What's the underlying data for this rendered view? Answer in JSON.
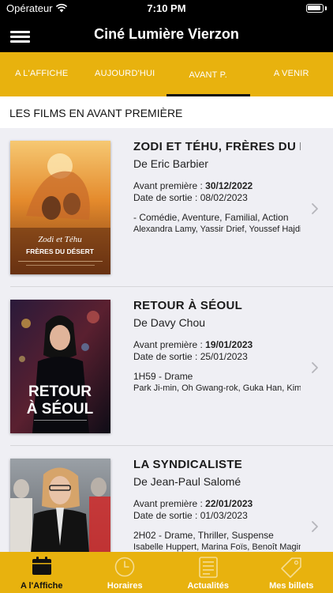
{
  "status": {
    "carrier": "Opérateur",
    "time": "7:10 PM"
  },
  "header": {
    "title": "Ciné Lumière Vierzon"
  },
  "tabs": [
    {
      "label": "A L'AFFICHE",
      "active": false
    },
    {
      "label": "AUJOURD'HUI",
      "active": false
    },
    {
      "label": "AVANT P.",
      "active": true
    },
    {
      "label": "A VENIR",
      "active": false
    }
  ],
  "section": {
    "title": "LES FILMS EN AVANT PREMIÈRE"
  },
  "films": [
    {
      "title": "ZODI ET TÉHU, FRÈRES DU DÉSERT",
      "director": "De Eric Barbier",
      "preview_label": "Avant première : ",
      "preview_date": "30/12/2022",
      "release": "Date de sortie : 08/02/2023",
      "genre": "- Comédie, Aventure, Familial, Action",
      "cast": "Alexandra Lamy, Yassir Drief, Youssef Hajdi",
      "poster_lines": [
        "Zodi et Téhu",
        "FRÈRES DU DÉSERT"
      ]
    },
    {
      "title": "RETOUR À SÉOUL",
      "director": "De Davy Chou",
      "preview_label": "Avant première : ",
      "preview_date": "19/01/2023",
      "release": "Date de sortie : 25/01/2023",
      "genre": "1H59 - Drame",
      "cast": "Park Ji-min, Oh Gwang-rok, Guka Han, Kim Sun-young",
      "poster_lines": [
        "RETOUR",
        "À SÉOUL"
      ]
    },
    {
      "title": "LA SYNDICALISTE",
      "director": "De Jean-Paul Salomé",
      "preview_label": "Avant première : ",
      "preview_date": "22/01/2023",
      "release": "Date de sortie : 01/03/2023",
      "genre": "2H02 - Drame, Thriller, Suspense",
      "cast": "Isabelle Huppert, Marina Foïs, Benoît Magimel",
      "poster_lines": []
    }
  ],
  "bottom_nav": [
    {
      "label": "A l'Affiche",
      "icon": "calendar-icon",
      "active": true
    },
    {
      "label": "Horaires",
      "icon": "clock-icon",
      "active": false
    },
    {
      "label": "Actualités",
      "icon": "news-icon",
      "active": false
    },
    {
      "label": "Mes billets",
      "icon": "ticket-icon",
      "active": false
    }
  ],
  "colors": {
    "accent": "#e8b20e",
    "header_bg": "#000000",
    "list_bg": "#efeff4"
  }
}
